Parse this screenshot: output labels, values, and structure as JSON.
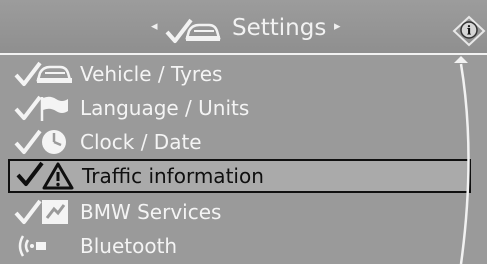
{
  "header": {
    "title": "Settings"
  },
  "menu": {
    "items": [
      {
        "label": "Vehicle / Tyres",
        "icon": "car-icon"
      },
      {
        "label": "Language / Units",
        "icon": "flag-icon"
      },
      {
        "label": "Clock / Date",
        "icon": "clock-icon"
      },
      {
        "label": "Traffic information",
        "icon": "warning-triangle-icon",
        "selected": true
      },
      {
        "label": "BMW Services",
        "icon": "bmw-services-icon"
      },
      {
        "label": "Bluetooth",
        "icon": "bluetooth-icon"
      }
    ]
  },
  "colors": {
    "background": "#9a9a9a",
    "text": "#f4f4f4",
    "selected_background": "#aaaaaa",
    "selected_text": "#0f0f0f"
  }
}
